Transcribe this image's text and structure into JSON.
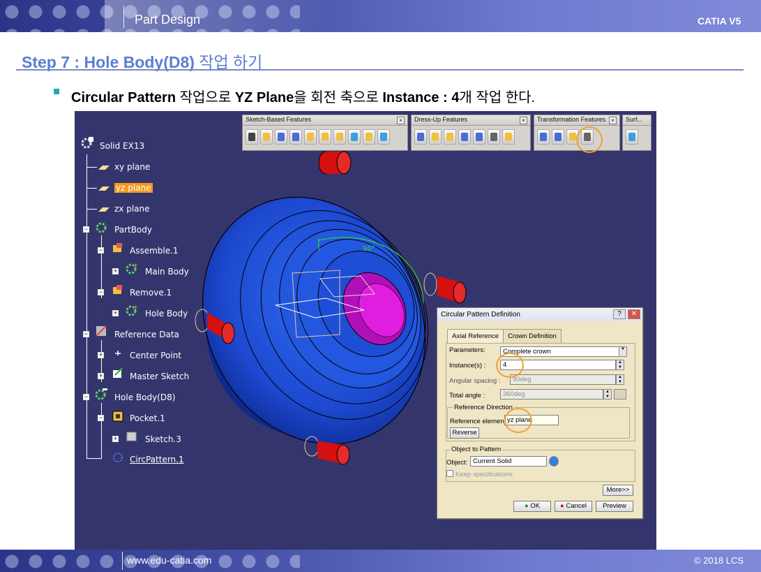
{
  "header": {
    "section": "Part Design",
    "product": "CATIA V5"
  },
  "footer": {
    "website": "www.edu-catia.com",
    "copyright": "© 2018 LCS"
  },
  "step": {
    "prefix": "Step 7 : Hole Body(D8)",
    "suffix": "작업 하기"
  },
  "instruction": {
    "part1": "Circular Pattern",
    "part2": " 작업으로 ",
    "part3": "YZ Plane",
    "part4": "을 회전 축으로 ",
    "part5": "Instance : 4",
    "part6": "개 작업 한다."
  },
  "toolbars": [
    {
      "title": "Sketch-Based Features",
      "icon_count": 10
    },
    {
      "title": "Dress-Up Features",
      "icon_count": 7
    },
    {
      "title": "Transformation Features",
      "icon_count": 4
    },
    {
      "title": "Surf...",
      "icon_count": 1
    }
  ],
  "tree": {
    "root": "Solid EX13",
    "items": [
      "xy plane",
      "yz plane",
      "zx plane",
      "PartBody",
      "Assemble.1",
      "Main Body",
      "Remove.1",
      "Hole Body",
      "Reference Data",
      "Center Point",
      "Master Sketch",
      "Hole Body(D8)",
      "Pocket.1",
      "Sketch.3",
      "CircPattern.1"
    ]
  },
  "viewport": {
    "angle_label": "90°"
  },
  "dialog": {
    "title": "Circular Pattern Definition",
    "help": "?",
    "close": "✕",
    "tabs": [
      "Axial Reference",
      "Crown Definition"
    ],
    "parameters_label": "Parameters:",
    "parameters_value": "Complete crown",
    "instances_label": "Instance(s) :",
    "instances_value": "4",
    "angular_label": "Angular spacing :",
    "angular_value": "90deg",
    "total_label": "Total angle :",
    "total_value": "360deg",
    "ref_dir_title": "Reference Direction",
    "ref_elem_label": "Reference element:",
    "ref_elem_value": "yz plane",
    "reverse": "Reverse",
    "object_title": "Object to Pattern",
    "object_label": "Object:",
    "object_value": "Current Solid",
    "keep_spec": "Keep specifications",
    "more": "More>>",
    "ok": "OK",
    "cancel": "Cancel",
    "preview": "Preview"
  },
  "colors": {
    "viewport_bg": "#35356e",
    "part_blue": "#1f4ed6",
    "hole_magenta": "#e01ee0",
    "highlight_orange": "#f39a1e",
    "dialog_bg": "#efe6c6"
  }
}
